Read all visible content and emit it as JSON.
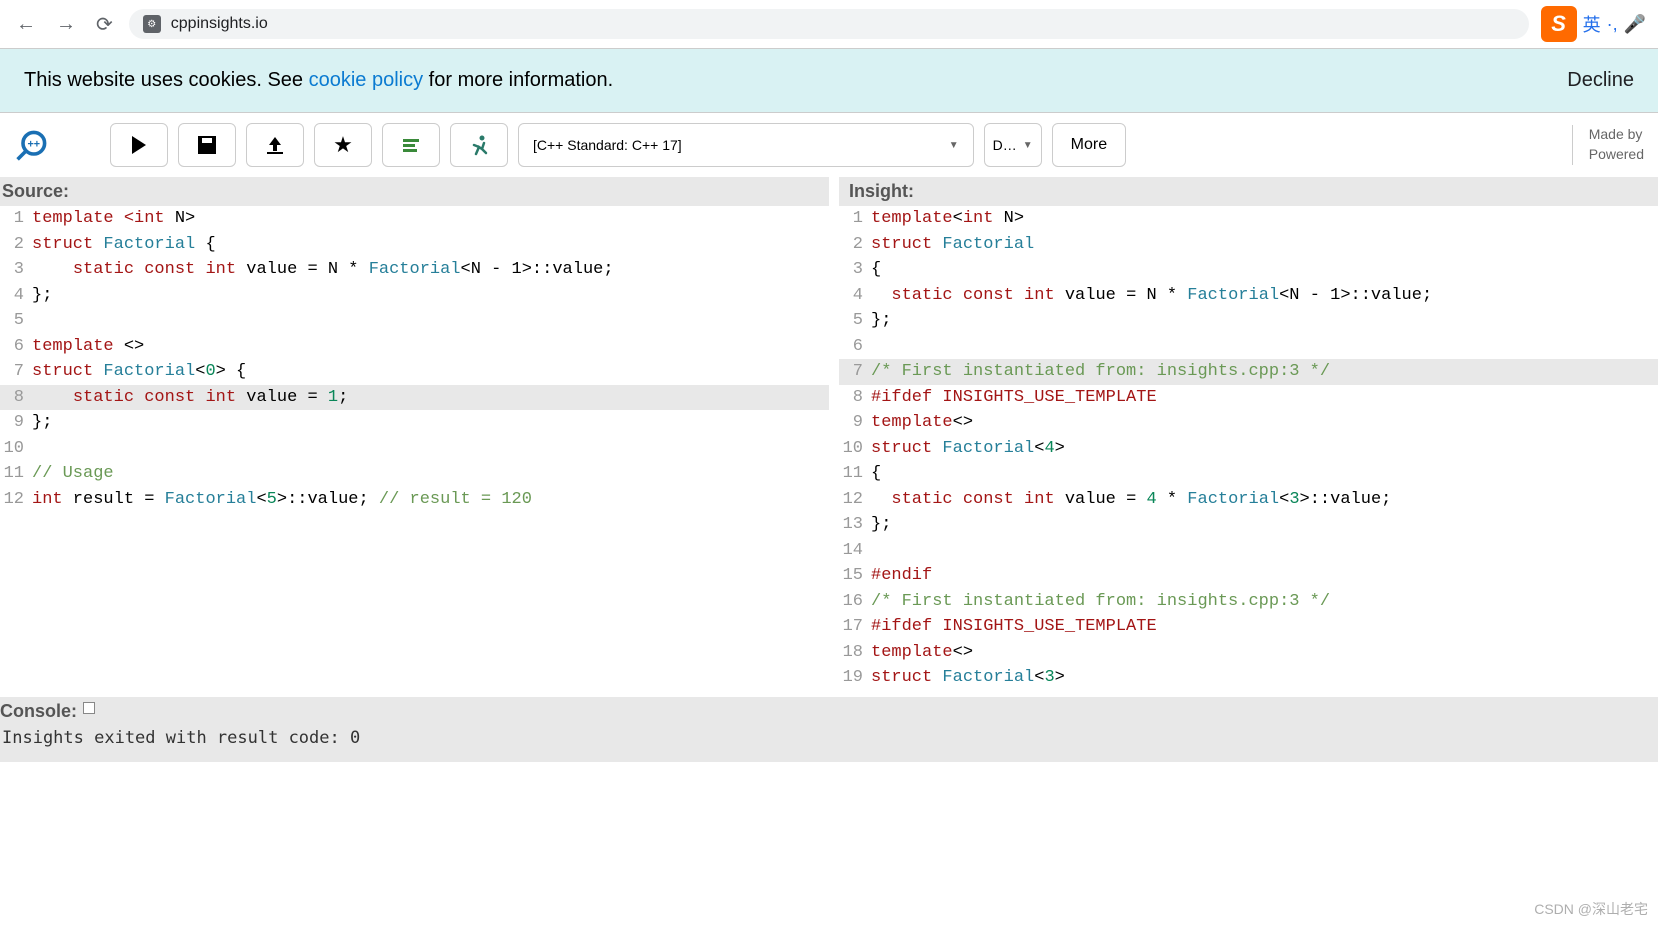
{
  "browser": {
    "url": "cppinsights.io",
    "lang_indicator": "英",
    "sogou_letter": "S"
  },
  "cookie": {
    "prefix": "This website uses cookies. See ",
    "link": "cookie policy",
    "suffix": " for more information.",
    "decline": "Decline"
  },
  "toolbar": {
    "standard_label": "[C++ Standard: C++ 17]",
    "short_select": "D…",
    "more_label": "More",
    "made_line1": "Made by ",
    "made_line2": "Powered "
  },
  "panes": {
    "source_label": "Source:",
    "insight_label": "Insight:"
  },
  "source": [
    {
      "ln": "1",
      "hl": false,
      "cls": [
        "kw",
        "",
        "kw",
        "",
        "kw",
        "",
        "",
        ""
      ],
      "seg": [
        "template",
        " ",
        "<",
        "",
        "int",
        " N",
        ">",
        ""
      ]
    },
    {
      "ln": "2",
      "hl": false,
      "cls": [
        "kw",
        "",
        "typ",
        "",
        ""
      ],
      "seg": [
        "struct",
        " ",
        "Factorial",
        " {",
        ""
      ]
    },
    {
      "ln": "3",
      "hl": false,
      "cls": [
        "",
        "kw",
        "",
        "kw",
        "",
        "kw",
        "",
        "",
        "",
        "typ",
        "",
        "",
        ""
      ],
      "seg": [
        "    ",
        "static",
        " ",
        "const",
        " ",
        "int",
        " value = N * ",
        "",
        "",
        "Factorial",
        "<N - ",
        "1",
        ">::value;"
      ]
    },
    {
      "ln": "4",
      "hl": false,
      "cls": [
        ""
      ],
      "seg": [
        "};"
      ]
    },
    {
      "ln": "5",
      "hl": false,
      "cls": [
        ""
      ],
      "seg": [
        ""
      ]
    },
    {
      "ln": "6",
      "hl": false,
      "cls": [
        "kw",
        "",
        ""
      ],
      "seg": [
        "template",
        " <>",
        ""
      ]
    },
    {
      "ln": "7",
      "hl": false,
      "cls": [
        "kw",
        "",
        "typ",
        "",
        "num",
        ""
      ],
      "seg": [
        "struct",
        " ",
        "Factorial",
        "<",
        "0",
        "> {"
      ]
    },
    {
      "ln": "8",
      "hl": true,
      "cls": [
        "",
        "kw",
        "",
        "kw",
        "",
        "kw",
        "",
        "num",
        ""
      ],
      "seg": [
        "    ",
        "static",
        " ",
        "const",
        " ",
        "int",
        " value = ",
        "1",
        ";"
      ]
    },
    {
      "ln": "9",
      "hl": false,
      "cls": [
        ""
      ],
      "seg": [
        "};"
      ]
    },
    {
      "ln": "10",
      "hl": false,
      "cls": [
        ""
      ],
      "seg": [
        ""
      ]
    },
    {
      "ln": "11",
      "hl": false,
      "cls": [
        "cmt"
      ],
      "seg": [
        "// Usage"
      ]
    },
    {
      "ln": "12",
      "hl": false,
      "cls": [
        "kw",
        "",
        "",
        "typ",
        "",
        "num",
        "",
        "cmt"
      ],
      "seg": [
        "int",
        " result = ",
        "",
        "Factorial",
        "<",
        "5",
        ">::value; ",
        "// result = 120"
      ]
    }
  ],
  "insight": [
    {
      "ln": "1",
      "hl": false,
      "cls": [
        "kw",
        "",
        "kw",
        "",
        ""
      ],
      "seg": [
        "template",
        "<",
        "int",
        " N>",
        ""
      ]
    },
    {
      "ln": "2",
      "hl": false,
      "cls": [
        "kw",
        "",
        "typ"
      ],
      "seg": [
        "struct",
        " ",
        "Factorial"
      ]
    },
    {
      "ln": "3",
      "hl": false,
      "cls": [
        ""
      ],
      "seg": [
        "{"
      ]
    },
    {
      "ln": "4",
      "hl": false,
      "cls": [
        "",
        "kw",
        "",
        "kw",
        "",
        "kw",
        "",
        "typ",
        "",
        "",
        ""
      ],
      "seg": [
        "  ",
        "static",
        " ",
        "const",
        " ",
        "int",
        " value = N * ",
        "Factorial",
        "<N - ",
        "1",
        ">::value;"
      ]
    },
    {
      "ln": "5",
      "hl": false,
      "cls": [
        ""
      ],
      "seg": [
        "};"
      ]
    },
    {
      "ln": "6",
      "hl": false,
      "cls": [
        ""
      ],
      "seg": [
        ""
      ]
    },
    {
      "ln": "7",
      "hl": true,
      "cls": [
        "cmt"
      ],
      "seg": [
        "/* First instantiated from: insights.cpp:3 */"
      ]
    },
    {
      "ln": "8",
      "hl": false,
      "cls": [
        "pp"
      ],
      "seg": [
        "#ifdef INSIGHTS_USE_TEMPLATE"
      ]
    },
    {
      "ln": "9",
      "hl": false,
      "cls": [
        "kw",
        ""
      ],
      "seg": [
        "template",
        "<>"
      ]
    },
    {
      "ln": "10",
      "hl": false,
      "cls": [
        "kw",
        "",
        "typ",
        "",
        "num",
        ""
      ],
      "seg": [
        "struct",
        " ",
        "Factorial",
        "<",
        "4",
        ">"
      ]
    },
    {
      "ln": "11",
      "hl": false,
      "cls": [
        ""
      ],
      "seg": [
        "{"
      ]
    },
    {
      "ln": "12",
      "hl": false,
      "cls": [
        "",
        "kw",
        "",
        "kw",
        "",
        "kw",
        "",
        "num",
        "",
        "typ",
        "",
        "num",
        ""
      ],
      "seg": [
        "  ",
        "static",
        " ",
        "const",
        " ",
        "int",
        " value = ",
        "4",
        " * ",
        "Factorial",
        "<",
        "3",
        ">::value;"
      ]
    },
    {
      "ln": "13",
      "hl": false,
      "cls": [
        ""
      ],
      "seg": [
        "};"
      ]
    },
    {
      "ln": "14",
      "hl": false,
      "cls": [
        ""
      ],
      "seg": [
        ""
      ]
    },
    {
      "ln": "15",
      "hl": false,
      "cls": [
        "pp"
      ],
      "seg": [
        "#endif"
      ]
    },
    {
      "ln": "16",
      "hl": false,
      "cls": [
        "cmt"
      ],
      "seg": [
        "/* First instantiated from: insights.cpp:3 */"
      ]
    },
    {
      "ln": "17",
      "hl": false,
      "cls": [
        "pp"
      ],
      "seg": [
        "#ifdef INSIGHTS_USE_TEMPLATE"
      ]
    },
    {
      "ln": "18",
      "hl": false,
      "cls": [
        "kw",
        ""
      ],
      "seg": [
        "template",
        "<>"
      ]
    },
    {
      "ln": "19",
      "hl": false,
      "cls": [
        "kw",
        "",
        "typ",
        "",
        "num",
        ""
      ],
      "seg": [
        "struct",
        " ",
        "Factorial",
        "<",
        "3",
        ">"
      ]
    }
  ],
  "console": {
    "label": "Console:",
    "output": "Insights exited with result code: 0"
  },
  "watermark": "CSDN @深山老宅"
}
